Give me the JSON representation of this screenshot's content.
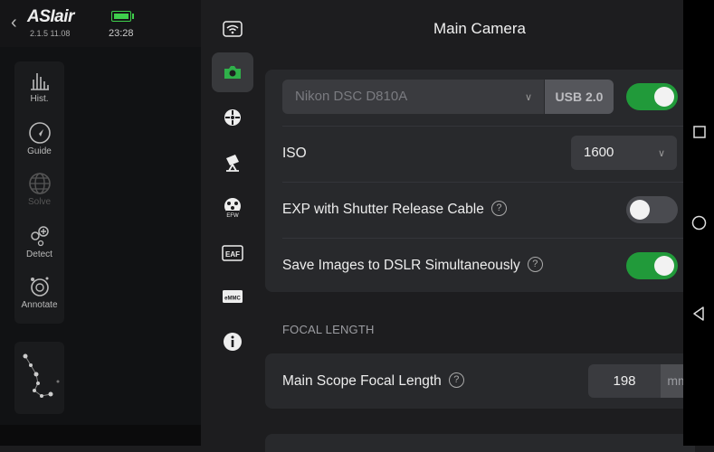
{
  "app": {
    "logo": "ASIair",
    "version": "2.1.5 11.08",
    "time": "23:28",
    "accent": "#219a3a"
  },
  "tools": [
    {
      "label": "Hist.",
      "icon": "histogram-icon"
    },
    {
      "label": "Guide",
      "icon": "guide-icon"
    },
    {
      "label": "Solve",
      "icon": "solve-icon"
    },
    {
      "label": "Detect",
      "icon": "detect-icon"
    },
    {
      "label": "Annotate",
      "icon": "annotate-icon"
    }
  ],
  "nav": [
    {
      "icon": "wifi-icon",
      "active": false
    },
    {
      "icon": "camera-icon",
      "active": true
    },
    {
      "icon": "guide-scope-icon",
      "active": false
    },
    {
      "icon": "telescope-mount-icon",
      "active": false
    },
    {
      "icon": "efw-icon",
      "active": false,
      "text": "EFW"
    },
    {
      "icon": "eaf-icon",
      "active": false,
      "text": "EAF"
    },
    {
      "icon": "emmc-icon",
      "active": false,
      "text": "eMMC"
    },
    {
      "icon": "info-icon",
      "active": false
    }
  ],
  "panel": {
    "title": "Main Camera",
    "camera": {
      "value": "Nikon DSC D810A",
      "usb": "USB 2.0",
      "enabled": true
    },
    "iso": {
      "label": "ISO",
      "value": "1600"
    },
    "exp_cable": {
      "label": "EXP with Shutter Release Cable",
      "enabled": false
    },
    "save_dslr": {
      "label": "Save Images to DSLR Simultaneously",
      "enabled": true
    },
    "focal_section": "FOCAL LENGTH",
    "focal": {
      "label": "Main Scope Focal Length",
      "value": "198",
      "unit": "mm"
    }
  }
}
